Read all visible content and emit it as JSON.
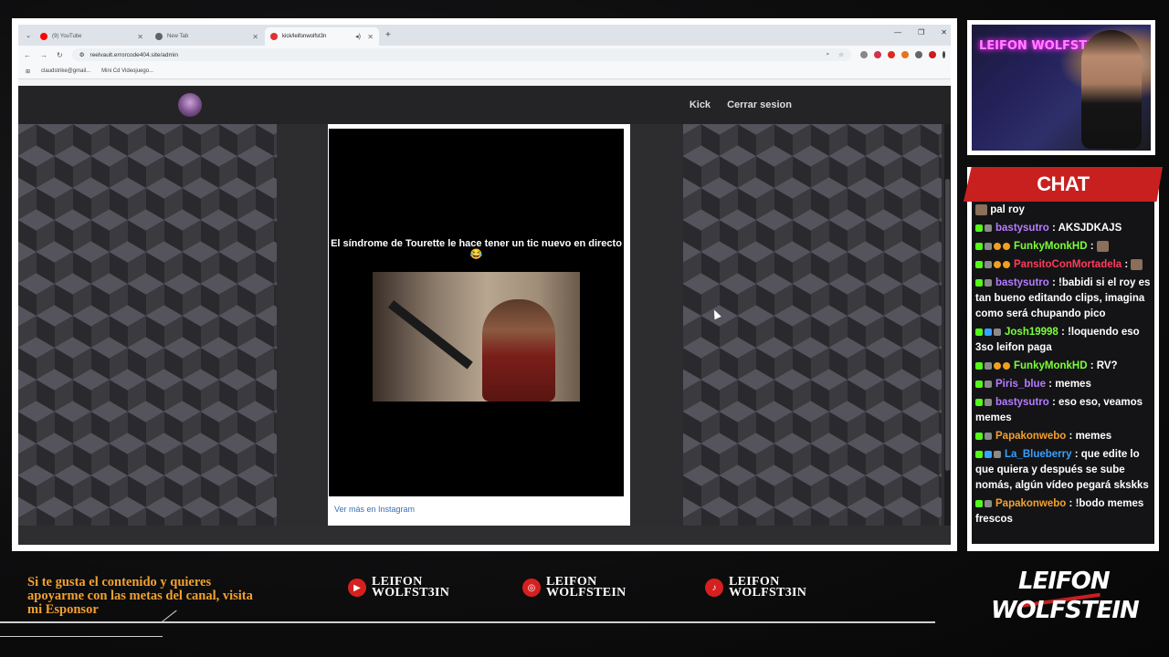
{
  "browser": {
    "tabs": [
      {
        "title": "(9) YouTube",
        "favicon_color": "#ff0000",
        "active": false
      },
      {
        "title": "New Tab",
        "favicon_color": "#5f6368",
        "active": false
      },
      {
        "title": "kick/leifonwolfst3n",
        "favicon_color": "#d33",
        "active": true
      }
    ],
    "url": "reelvault.errorcode404.site/admin",
    "bookmarks": [
      "claudstrike@gmail...",
      "Mini Cd Videojuego..."
    ]
  },
  "site": {
    "nav": [
      "Kick",
      "Cerrar sesion"
    ],
    "embed": {
      "caption": "El síndrome de Tourette le hace tener un tic nuevo en directo 😂",
      "link": "Ver más en Instagram"
    }
  },
  "overlay": {
    "neon_sign": "LEIFON WOLFSTEIN",
    "chat_title": "CHAT",
    "chat": [
      {
        "user": "",
        "text": "pal roy",
        "color": "#ffffff",
        "badges": []
      },
      {
        "user": "bastysutro",
        "text": "AKSJDKAJS",
        "color": "#b57cff",
        "badges": [
          "k",
          "s"
        ]
      },
      {
        "user": "FunkyMonkHD",
        "text": "",
        "color": "#7cff3a",
        "badges": [
          "k",
          "s",
          "y",
          "y"
        ]
      },
      {
        "user": "PansitoConMortadela",
        "text": "",
        "color": "#ff3b5c",
        "badges": [
          "k",
          "s",
          "y",
          "y"
        ]
      },
      {
        "user": "bastysutro",
        "text": "!babidi si el roy es tan bueno editando clips, imagina como será chupando pico",
        "color": "#b57cff",
        "badges": [
          "k",
          "s"
        ]
      },
      {
        "user": "Josh19998",
        "text": "!loquendo eso 3so leifon paga",
        "color": "#7cff3a",
        "badges": [
          "k",
          "b",
          "s"
        ]
      },
      {
        "user": "FunkyMonkHD",
        "text": "RV?",
        "color": "#7cff3a",
        "badges": [
          "k",
          "s",
          "y",
          "y"
        ]
      },
      {
        "user": "Piris_blue",
        "text": "memes",
        "color": "#b57cff",
        "badges": [
          "k",
          "s"
        ]
      },
      {
        "user": "bastysutro",
        "text": "eso eso, veamos memes",
        "color": "#b57cff",
        "badges": [
          "k",
          "s"
        ]
      },
      {
        "user": "Papakonwebo",
        "text": "memes",
        "color": "#f3a12e",
        "badges": [
          "k",
          "s"
        ]
      },
      {
        "user": "La_Blueberry",
        "text": "que edite lo que quiera y después se sube nomás, algún vídeo pegará skskks",
        "color": "#38a0ff",
        "badges": [
          "k",
          "b",
          "s"
        ]
      },
      {
        "user": "Papakonwebo",
        "text": "!bodo memes frescos",
        "color": "#f3a12e",
        "badges": [
          "k",
          "s"
        ]
      }
    ],
    "support_text": "Si te gusta el contenido y quieres apoyarme con las metas del canal, visita mi Esponsor",
    "socials": [
      {
        "platform": "youtube-icon",
        "name": "LEIFON WOLFST3IN"
      },
      {
        "platform": "instagram-icon",
        "name": "LEIFON WOLFSTEIN"
      },
      {
        "platform": "tiktok-icon",
        "name": "LEIFON WOLFST3IN"
      }
    ],
    "brand_line1": "LEIFON",
    "brand_line2": "WOLFSTEIN"
  }
}
